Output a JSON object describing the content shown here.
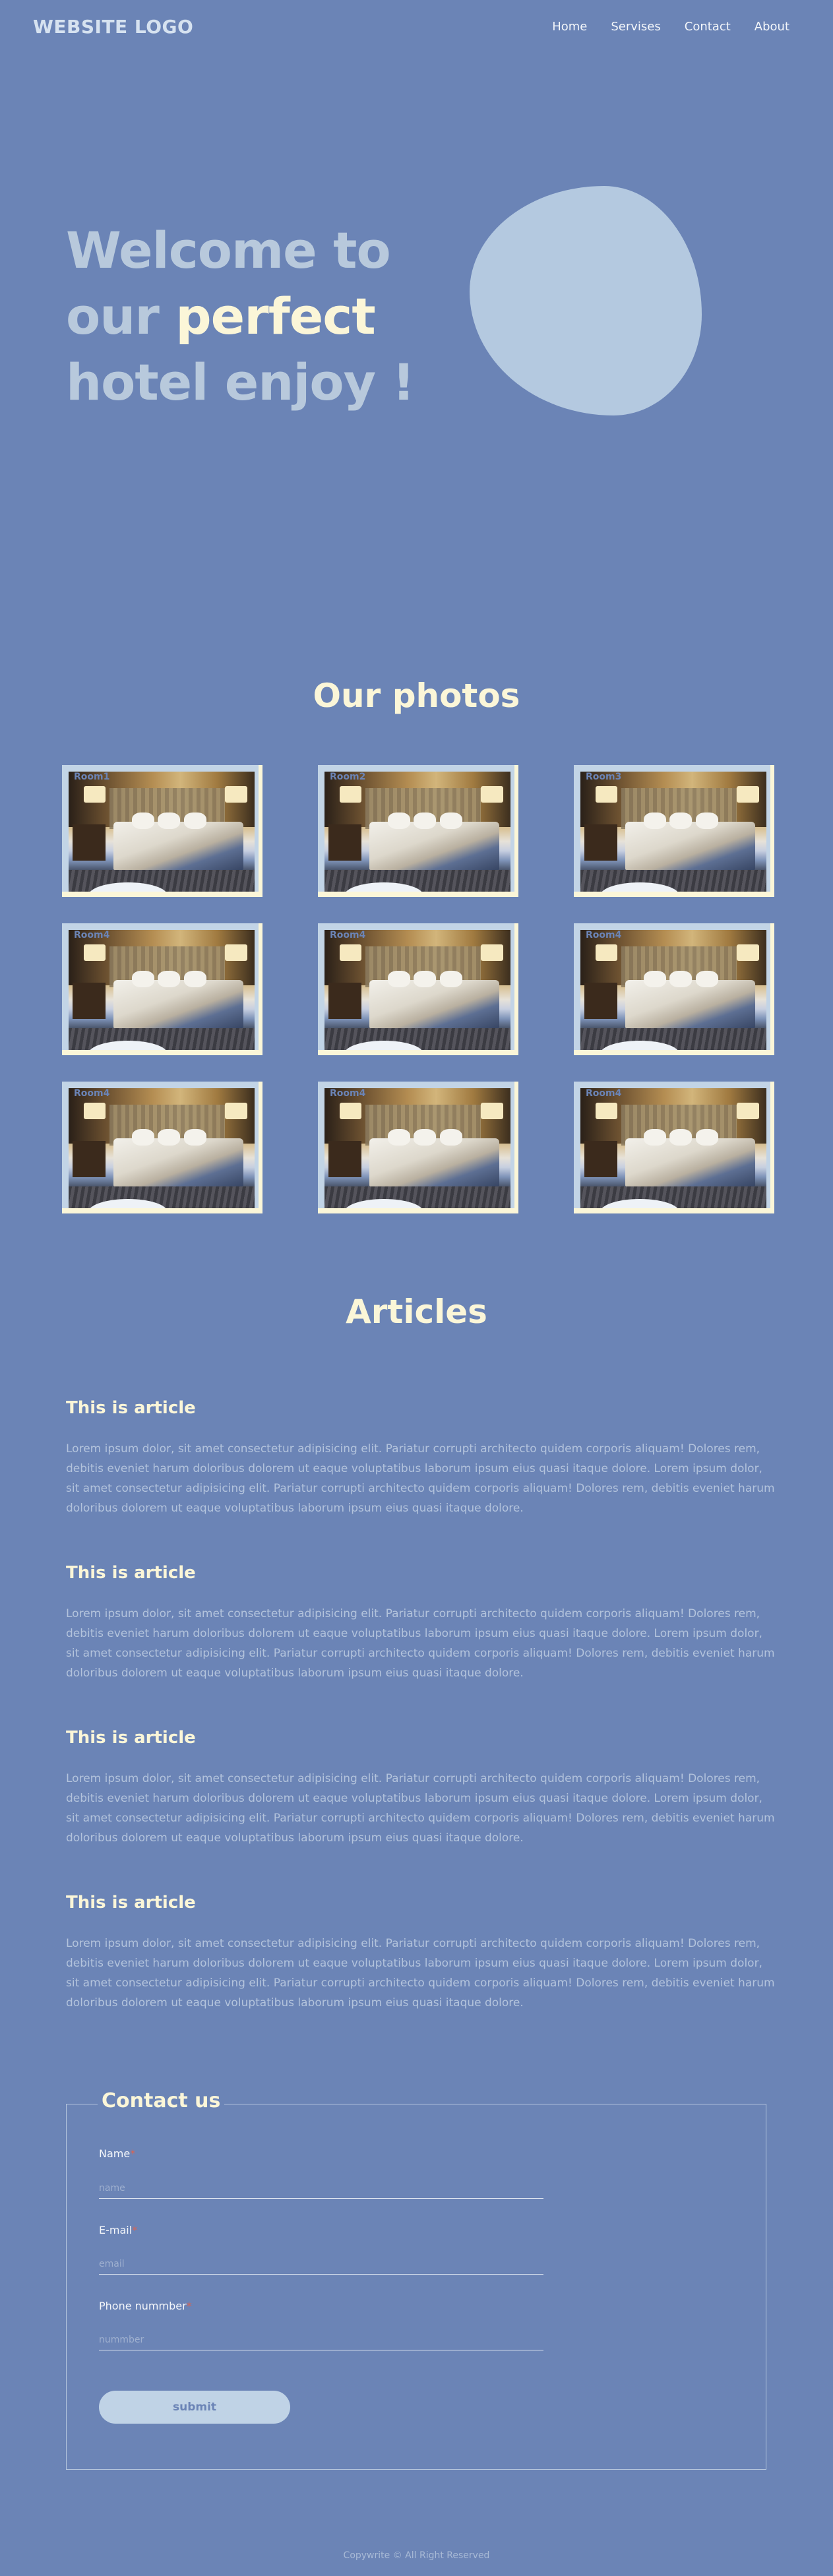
{
  "header": {
    "logo": "WEBSITE LOGO",
    "nav": [
      "Home",
      "Servises",
      "Contact",
      "About"
    ]
  },
  "hero": {
    "line1": "Welcome to",
    "line2_a": "our ",
    "line2_b": "perfect",
    "line3": "hotel enjoy !"
  },
  "photos": {
    "title": "Our photos",
    "items": [
      {
        "label": "Room1"
      },
      {
        "label": "Room2"
      },
      {
        "label": "Room3"
      },
      {
        "label": "Room4"
      },
      {
        "label": "Room4"
      },
      {
        "label": "Room4"
      },
      {
        "label": "Room4"
      },
      {
        "label": "Room4"
      },
      {
        "label": "Room4"
      }
    ]
  },
  "articles": {
    "title": "Articles",
    "items": [
      {
        "title": "This is article",
        "body": "Lorem ipsum dolor, sit amet consectetur adipisicing elit. Pariatur corrupti architecto quidem corporis aliquam! Dolores rem, debitis eveniet harum doloribus dolorem ut eaque voluptatibus laborum ipsum eius quasi itaque dolore. Lorem ipsum dolor, sit amet consectetur adipisicing elit. Pariatur corrupti architecto quidem corporis aliquam! Dolores rem, debitis eveniet harum doloribus dolorem ut eaque voluptatibus laborum ipsum eius quasi itaque dolore."
      },
      {
        "title": "This is article",
        "body": "Lorem ipsum dolor, sit amet consectetur adipisicing elit. Pariatur corrupti architecto quidem corporis aliquam! Dolores rem, debitis eveniet harum doloribus dolorem ut eaque voluptatibus laborum ipsum eius quasi itaque dolore. Lorem ipsum dolor, sit amet consectetur adipisicing elit. Pariatur corrupti architecto quidem corporis aliquam! Dolores rem, debitis eveniet harum doloribus dolorem ut eaque voluptatibus laborum ipsum eius quasi itaque dolore."
      },
      {
        "title": "This is article",
        "body": "Lorem ipsum dolor, sit amet consectetur adipisicing elit. Pariatur corrupti architecto quidem corporis aliquam! Dolores rem, debitis eveniet harum doloribus dolorem ut eaque voluptatibus laborum ipsum eius quasi itaque dolore. Lorem ipsum dolor, sit amet consectetur adipisicing elit. Pariatur corrupti architecto quidem corporis aliquam! Dolores rem, debitis eveniet harum doloribus dolorem ut eaque voluptatibus laborum ipsum eius quasi itaque dolore."
      },
      {
        "title": "This is article",
        "body": "Lorem ipsum dolor, sit amet consectetur adipisicing elit. Pariatur corrupti architecto quidem corporis aliquam! Dolores rem, debitis eveniet harum doloribus dolorem ut eaque voluptatibus laborum ipsum eius quasi itaque dolore. Lorem ipsum dolor, sit amet consectetur adipisicing elit. Pariatur corrupti architecto quidem corporis aliquam! Dolores rem, debitis eveniet harum doloribus dolorem ut eaque voluptatibus laborum ipsum eius quasi itaque dolore."
      }
    ]
  },
  "contact": {
    "title": "Contact us",
    "fields": [
      {
        "label": "Name",
        "placeholder": "name"
      },
      {
        "label": "E-mail",
        "placeholder": "email"
      },
      {
        "label": "Phone nummber",
        "placeholder": "nummber"
      }
    ],
    "required_mark": "*",
    "submit": "submit"
  },
  "footer": {
    "text": "Copywrite © All Right Reserved"
  },
  "colors": {
    "background": "#6b84b6",
    "accent_cream": "#fbf6d8",
    "light_blue": "#b8c9dc"
  }
}
